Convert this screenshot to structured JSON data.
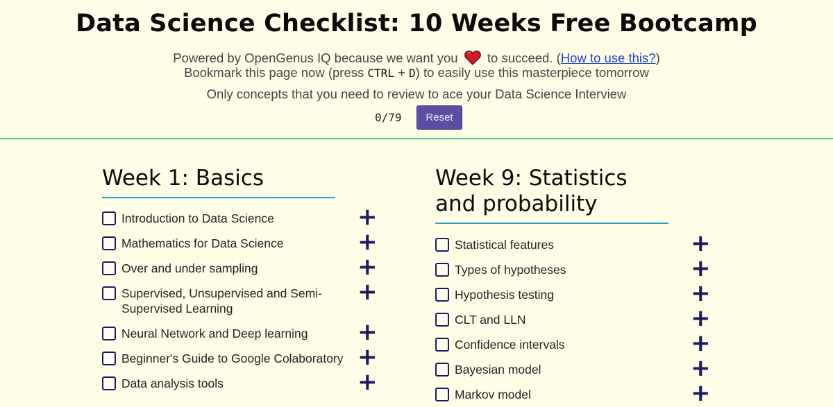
{
  "header": {
    "title": "Data Science Checklist: 10 Weeks Free Bootcamp",
    "powered_prefix": "Powered by OpenGenus IQ because we want you",
    "heart_icon": "heart-icon",
    "powered_suffix": "to succeed. (",
    "how_to_link": "How to use this?",
    "powered_close": ")",
    "bookmark_prefix": "Bookmark this page now (press",
    "key_ctrl": "CTRL",
    "plus_sign": "+",
    "key_d": "D",
    "bookmark_suffix": ") to easily use this masterpiece tomorrow",
    "tagline": "Only concepts that you need to review to ace your Data Science Interview",
    "counter": "0/79",
    "reset_label": "Reset",
    "accent_color": "#4fcc8a"
  },
  "weeks": [
    {
      "title": "Week 1: Basics",
      "items": [
        "Introduction to Data Science",
        "Mathematics for Data Science",
        "Over and under sampling",
        "Supervised, Unsupervised and Semi-Supervised Learning",
        "Neural Network and Deep learning",
        "Beginner's Guide to Google Colaboratory",
        "Data analysis tools"
      ]
    },
    {
      "title": "Week 9: Statistics and probability",
      "items": [
        "Statistical features",
        "Types of hypotheses",
        "Hypothesis testing",
        "CLT and LLN",
        "Confidence intervals",
        "Bayesian model",
        "Markov model"
      ]
    }
  ],
  "expand_icon": "+"
}
